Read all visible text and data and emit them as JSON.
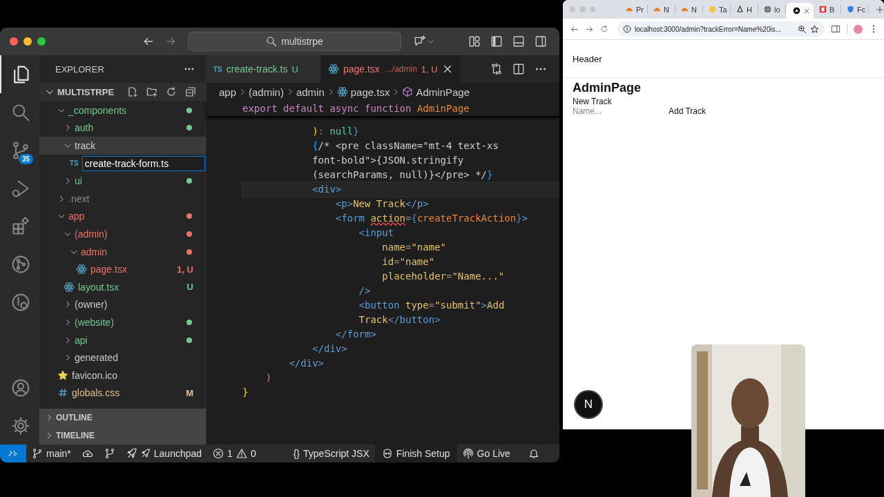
{
  "vscode": {
    "search": "multistrpe",
    "activity": [
      {
        "kind": "files",
        "selected": true
      },
      {
        "kind": "search",
        "selected": false
      },
      {
        "kind": "scm",
        "selected": false,
        "badge": "35"
      },
      {
        "kind": "debug",
        "selected": false
      },
      {
        "kind": "extensions",
        "selected": false
      },
      {
        "kind": "gitgraph",
        "selected": false
      },
      {
        "kind": "remote",
        "selected": false
      }
    ],
    "activity_bottom": [
      {
        "kind": "account"
      },
      {
        "kind": "settings"
      }
    ],
    "explorer": {
      "title": "EXPLORER",
      "root": "MULTISTRPE",
      "root_expanded": true,
      "tree": [
        {
          "label": "_components",
          "kind": "folder",
          "expanded": true,
          "color": "#73c991",
          "dot": true,
          "selected": false,
          "editing": false,
          "children": [
            {
              "label": "auth",
              "kind": "folder",
              "expanded": false,
              "color": "#73c991",
              "dot": true,
              "selected": false,
              "editing": false
            },
            {
              "label": "track",
              "kind": "folder",
              "expanded": true,
              "color": "#cccccc",
              "dot": false,
              "selected": true,
              "editing": false,
              "children": [
                {
                  "label": "create-track-form.ts",
                  "kind": "ts_file",
                  "icon_text": "TS",
                  "color": "#ffffff",
                  "dot": false,
                  "selected": false,
                  "editing": true
                }
              ]
            },
            {
              "label": "ui",
              "kind": "folder",
              "expanded": false,
              "color": "#73c991",
              "dot": true,
              "selected": false,
              "editing": false
            }
          ]
        },
        {
          "label": ".next",
          "kind": "folder",
          "expanded": false,
          "color": "#8c8c8c",
          "dot": false,
          "selected": false,
          "editing": false
        },
        {
          "label": "app",
          "kind": "folder",
          "expanded": true,
          "color": "#e8736a",
          "dot": true,
          "selected": false,
          "editing": false,
          "children": [
            {
              "label": "(admin)",
              "kind": "folder",
              "expanded": true,
              "color": "#e8736a",
              "dot": true,
              "selected": false,
              "editing": false,
              "children": [
                {
                  "label": "admin",
                  "kind": "folder",
                  "expanded": true,
                  "color": "#e8736a",
                  "dot": true,
                  "selected": false,
                  "editing": false,
                  "children": [
                    {
                      "label": "page.tsx",
                      "kind": "react_file",
                      "color": "#e8736a",
                      "dot": false,
                      "badge": "1, U",
                      "selected": false,
                      "editing": false
                    }
                  ]
                }
              ]
            },
            {
              "label": "layout.tsx",
              "kind": "react_file",
              "color": "#73c991",
              "dot": false,
              "badge": "U",
              "selected": false,
              "editing": false
            },
            {
              "label": "(owner)",
              "kind": "folder",
              "expanded": false,
              "color": "#cccccc",
              "dot": false,
              "selected": false,
              "editing": false
            },
            {
              "label": "(website)",
              "kind": "folder",
              "expanded": false,
              "color": "#73c991",
              "dot": true,
              "selected": false,
              "editing": false
            },
            {
              "label": "api",
              "kind": "folder",
              "expanded": false,
              "color": "#73c991",
              "dot": true,
              "selected": false,
              "editing": false
            },
            {
              "label": "generated",
              "kind": "folder",
              "expanded": false,
              "color": "#cccccc",
              "dot": false,
              "selected": false,
              "editing": false
            }
          ]
        },
        {
          "label": "favicon.ico",
          "kind": "star_file",
          "color": "#cccccc",
          "dot": false,
          "selected": false,
          "editing": false
        },
        {
          "label": "globals.css",
          "kind": "css_file",
          "color": "#e2c08d",
          "dot": false,
          "badge": "M",
          "selected": false,
          "editing": false
        }
      ],
      "sections": [
        {
          "label": "OUTLINE",
          "expanded": false
        },
        {
          "label": "TIMELINE",
          "expanded": false
        }
      ]
    },
    "editor": {
      "tabs": [
        {
          "label": "create-track.ts",
          "kind": "ts",
          "icon_text": "TS",
          "badge": "U",
          "color": "#73c991",
          "selected": false
        },
        {
          "label": "page.tsx",
          "kind": "tsx",
          "detail": ".../admin",
          "badge": "1, U",
          "color": "#f0766b",
          "selected": true
        }
      ],
      "breadcrumbs": [
        {
          "label": "app",
          "kind": "folder"
        },
        {
          "label": "(admin)",
          "kind": "folder"
        },
        {
          "label": "admin",
          "kind": "folder"
        },
        {
          "label": "page.tsx",
          "kind": "file"
        },
        {
          "label": "AdminPage",
          "kind": "symbol"
        }
      ],
      "sticky": [
        {
          "kind": "keyword",
          "text": "export default async function "
        },
        {
          "kind": "func",
          "text": "AdminPage"
        }
      ],
      "code": [
        {
          "children": [
            {
              "children": [
                {
                  "children": [
                    {
                      "current": false,
                      "tokens": [
                        {
                          "kind": "b1",
                          "text": ")"
                        },
                        {
                          "kind": "punct",
                          "text": ": "
                        },
                        {
                          "kind": "null",
                          "text": "null"
                        },
                        {
                          "kind": "b3",
                          "text": "}"
                        }
                      ]
                    },
                    {
                      "current": false,
                      "tokens": [
                        {
                          "kind": "b3",
                          "text": "{"
                        },
                        {
                          "kind": "comment",
                          "text": "/* <pre className=\"mt-4 text-xs"
                        }
                      ]
                    },
                    {
                      "current": false,
                      "tokens": [
                        {
                          "kind": "comment",
                          "text": "font-bold\">{JSON.stringify"
                        }
                      ]
                    },
                    {
                      "current": false,
                      "tokens": [
                        {
                          "kind": "comment",
                          "text": "(searchParams, null)}</pre> */"
                        },
                        {
                          "kind": "b3",
                          "text": "}"
                        }
                      ]
                    },
                    {
                      "current": true,
                      "tokens": [
                        {
                          "kind": "tag",
                          "text": "<div>"
                        }
                      ],
                      "children": [
                        {
                          "current": false,
                          "tokens": [
                            {
                              "kind": "tag",
                              "text": "<p>"
                            },
                            {
                              "kind": "text",
                              "text": "New Track"
                            },
                            {
                              "kind": "tag",
                              "text": "</p>"
                            }
                          ]
                        },
                        {
                          "current": false,
                          "tokens": [
                            {
                              "kind": "tag",
                              "text": "<form "
                            },
                            {
                              "kind": "attr_error",
                              "text": "action"
                            },
                            {
                              "kind": "punct",
                              "text": "="
                            },
                            {
                              "kind": "b3",
                              "text": "{"
                            },
                            {
                              "kind": "func",
                              "text": "createTrackAction"
                            },
                            {
                              "kind": "b3",
                              "text": "}"
                            },
                            {
                              "kind": "tag",
                              "text": ">"
                            }
                          ],
                          "children": [
                            {
                              "current": false,
                              "tokens": [
                                {
                                  "kind": "tag",
                                  "text": "<input"
                                }
                              ],
                              "children": [
                                {
                                  "current": false,
                                  "tokens": [
                                    {
                                      "kind": "attr",
                                      "text": "name"
                                    },
                                    {
                                      "kind": "punct",
                                      "text": "="
                                    },
                                    {
                                      "kind": "str",
                                      "text": "\"name\""
                                    }
                                  ]
                                },
                                {
                                  "current": false,
                                  "tokens": [
                                    {
                                      "kind": "attr",
                                      "text": "id"
                                    },
                                    {
                                      "kind": "punct",
                                      "text": "="
                                    },
                                    {
                                      "kind": "str",
                                      "text": "\"name\""
                                    }
                                  ]
                                },
                                {
                                  "current": false,
                                  "tokens": [
                                    {
                                      "kind": "attr",
                                      "text": "placeholder"
                                    },
                                    {
                                      "kind": "punct",
                                      "text": "="
                                    },
                                    {
                                      "kind": "str",
                                      "text": "\"Name...\""
                                    }
                                  ]
                                }
                              ]
                            },
                            {
                              "current": false,
                              "tokens": [
                                {
                                  "kind": "tag",
                                  "text": "/>"
                                }
                              ]
                            },
                            {
                              "current": false,
                              "tokens": [
                                {
                                  "kind": "tag",
                                  "text": "<button "
                                },
                                {
                                  "kind": "attr",
                                  "text": "type"
                                },
                                {
                                  "kind": "punct",
                                  "text": "="
                                },
                                {
                                  "kind": "str",
                                  "text": "\"submit\""
                                },
                                {
                                  "kind": "tag",
                                  "text": ">"
                                },
                                {
                                  "kind": "text",
                                  "text": "Add"
                                }
                              ]
                            },
                            {
                              "current": false,
                              "tokens": [
                                {
                                  "kind": "text",
                                  "text": "Track"
                                },
                                {
                                  "kind": "tag",
                                  "text": "</button>"
                                }
                              ]
                            }
                          ]
                        },
                        {
                          "current": false,
                          "tokens": [
                            {
                              "kind": "tag",
                              "text": "</form>"
                            }
                          ]
                        }
                      ]
                    },
                    {
                      "current": false,
                      "tokens": [
                        {
                          "kind": "tag",
                          "text": "</div>"
                        }
                      ]
                    }
                  ]
                },
                {
                  "current": false,
                  "tokens": [
                    {
                      "kind": "tag",
                      "text": "</div>"
                    }
                  ]
                }
              ]
            },
            {
              "current": false,
              "tokens": [
                {
                  "kind": "b2",
                  "text": ")"
                }
              ]
            }
          ]
        },
        {
          "current": false,
          "tokens": [
            {
              "kind": "b1",
              "text": "}"
            }
          ]
        }
      ]
    },
    "status_bar": [
      {
        "kind": "remote"
      },
      {
        "kind": "branch",
        "text": "main*"
      },
      {
        "kind": "sync"
      },
      {
        "kind": "graph"
      },
      {
        "kind": "launchpad",
        "text": "Launchpad"
      },
      {
        "kind": "problems",
        "errors": "1",
        "warnings": "0"
      },
      {
        "kind": "language",
        "icon_text": "{}",
        "text": "TypeScript JSX"
      },
      {
        "kind": "copilot",
        "text": "Finish Setup"
      },
      {
        "kind": "golive",
        "text": "Go Live"
      },
      {
        "kind": "bell"
      }
    ]
  },
  "browser": {
    "tabs": [
      {
        "title": "Pr",
        "kind": "cloud",
        "selected": false
      },
      {
        "title": "N",
        "kind": "cloud",
        "selected": false
      },
      {
        "title": "N",
        "kind": "cloud",
        "selected": false
      },
      {
        "title": "Ta",
        "kind": "face",
        "selected": false
      },
      {
        "title": "H",
        "kind": "drop",
        "selected": false
      },
      {
        "title": "lo",
        "kind": "globe",
        "selected": false
      },
      {
        "kind": "dark",
        "selected": true
      },
      {
        "title": "B",
        "kind": "square",
        "selected": false
      },
      {
        "title": "Fc",
        "kind": "shield",
        "selected": false
      }
    ],
    "url": "localhost:3000/admin?trackError=Name%20is...",
    "page": {
      "header": "Header",
      "title": "AdminPage",
      "subtitle": "New Track",
      "input_placeholder": "Name...",
      "button": "Add Track",
      "dev_badge": "N"
    }
  }
}
